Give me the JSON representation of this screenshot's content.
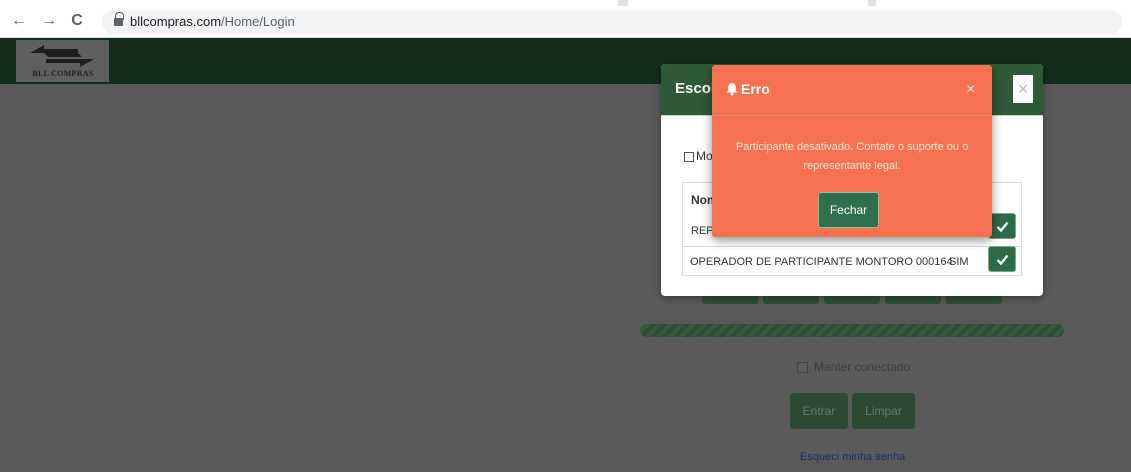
{
  "browser": {
    "url_host": "bllcompras.com",
    "url_path": "/Home/Login",
    "back_glyph": "←",
    "forward_glyph": "→",
    "reload_glyph": "C"
  },
  "site": {
    "logo_text": "BLL COMPRAS"
  },
  "login": {
    "keep_connected": "Manter conectado",
    "enter_button": "Entrar",
    "clear_button": "Limpar",
    "forgot_password": "Esqueci minha senha"
  },
  "choose_modal": {
    "title": "Escol",
    "close_glyph": "×",
    "checkbox_label": "Mo",
    "table_header_name": "Nom",
    "rows": [
      {
        "name": "REPR",
        "value": ""
      },
      {
        "name": "OPERADOR DE PARTICIPANTE MONTORO 000164",
        "value": "SIM"
      }
    ]
  },
  "error_modal": {
    "title": "Erro",
    "close_glyph": "×",
    "message": "Participante desativado. Contate o suporte ou o representante legal.",
    "close_button": "Fechar"
  },
  "colors": {
    "header_green": "#142d1d",
    "modal_header_green": "#2e5a37",
    "error_orange": "#f57152",
    "button_green": "#2f6f4d"
  }
}
